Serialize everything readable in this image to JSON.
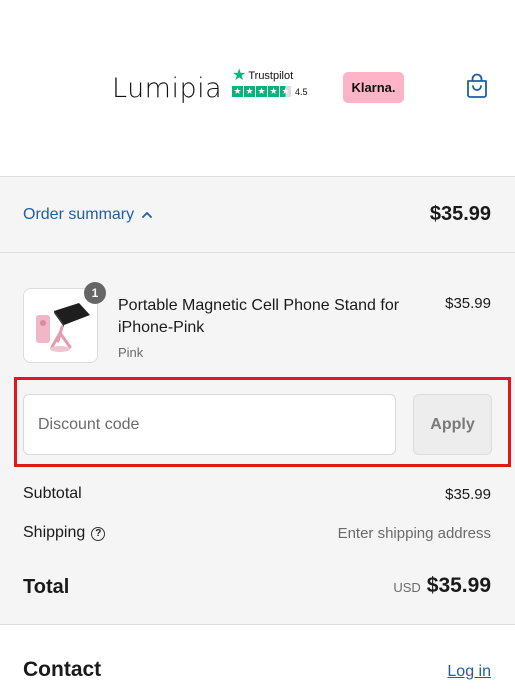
{
  "header": {
    "logo": "Lumipia",
    "trustpilot": {
      "label": "Trustpilot",
      "score": "4.5",
      "rating": 4.5
    },
    "klarna": "Klarna.",
    "cart_icon": "shopping-bag-icon"
  },
  "summary": {
    "toggle_label": "Order summary",
    "toggle_icon": "chevron-up-icon",
    "total": "$35.99"
  },
  "item": {
    "quantity": "1",
    "title": "Portable Magnetic Cell Phone Stand for iPhone-Pink",
    "variant": "Pink",
    "price": "$35.99"
  },
  "discount": {
    "placeholder": "Discount code",
    "apply_label": "Apply"
  },
  "totals": {
    "subtotal_label": "Subtotal",
    "subtotal_value": "$35.99",
    "shipping_label": "Shipping",
    "shipping_value": "Enter shipping address",
    "total_label": "Total",
    "currency": "USD",
    "total_value": "$35.99"
  },
  "contact": {
    "title": "Contact",
    "login_label": "Log in"
  },
  "colors": {
    "link": "#1f5fa5",
    "trustpilot_green": "#00b67a",
    "klarna_pink": "#ffb3c7",
    "highlight_red": "#e8141c"
  }
}
